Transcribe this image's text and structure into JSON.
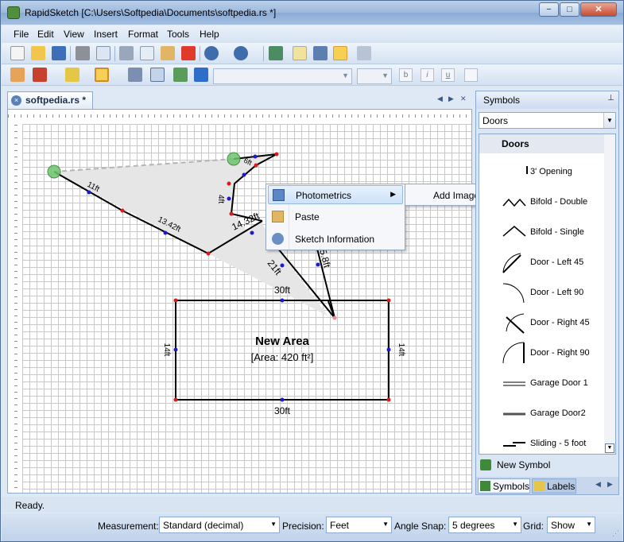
{
  "window": {
    "title": "RapidSketch [C:\\Users\\Softpedia\\Documents\\softpedia.rs *]",
    "minimize": "−",
    "maximize": "□",
    "close": "✕"
  },
  "menu": [
    "File",
    "Edit",
    "View",
    "Insert",
    "Format",
    "Tools",
    "Help"
  ],
  "toolbar": {
    "font_formats": [
      "b",
      "i",
      "u"
    ]
  },
  "document_tab": {
    "label": "softpedia.rs *",
    "close": "×"
  },
  "sketch": {
    "area_title": "New Area",
    "area_subtitle": "[Area: 420 ft²]",
    "dim_top": "30ft",
    "dim_bottom": "30ft",
    "dim_left": "14ft",
    "dim_right": "14ft",
    "seg_11ft": "11ft",
    "seg_1342ft": "13.42ft",
    "seg_4ft": "4ft",
    "seg_6ft": "6ft",
    "seg_1432ft": "14.32ft",
    "seg_21ft": "21ft",
    "seg_58ft": "5.8ft"
  },
  "context_menu": {
    "items": [
      "Photometrics",
      "Paste",
      "Sketch Information"
    ],
    "submenu_arrow": "▶",
    "submenu": [
      "Add Image"
    ]
  },
  "symbols_panel": {
    "title": "Symbols",
    "pin": "📌",
    "category_select": "Doors",
    "category_header": "Doors",
    "items": [
      "3' Opening",
      "Bifold - Double",
      "Bifold - Single",
      "Door - Left 45",
      "Door - Left 90",
      "Door - Right 45",
      "Door - Right 90",
      "Garage Door 1",
      "Garage Door2",
      "Sliding - 5 foot"
    ],
    "new_symbol": "New Symbol",
    "tabs": [
      "Symbols",
      "Labels"
    ]
  },
  "status": {
    "text": "Ready."
  },
  "bottom": {
    "measurement_label": "Measurement:",
    "measurement_value": "Standard (decimal)",
    "precision_label": "Precision:",
    "precision_value": "Feet",
    "angle_snap_label": "Angle Snap:",
    "angle_snap_value": "5 degrees",
    "grid_label": "Grid:",
    "grid_value": "Show"
  },
  "colors": {
    "accent": "#c7e0f9",
    "shape_fill": "#e6e6e6",
    "node_blue": "#1a1ad6",
    "node_red": "#e01818",
    "handle_green": "#6cc56c"
  }
}
